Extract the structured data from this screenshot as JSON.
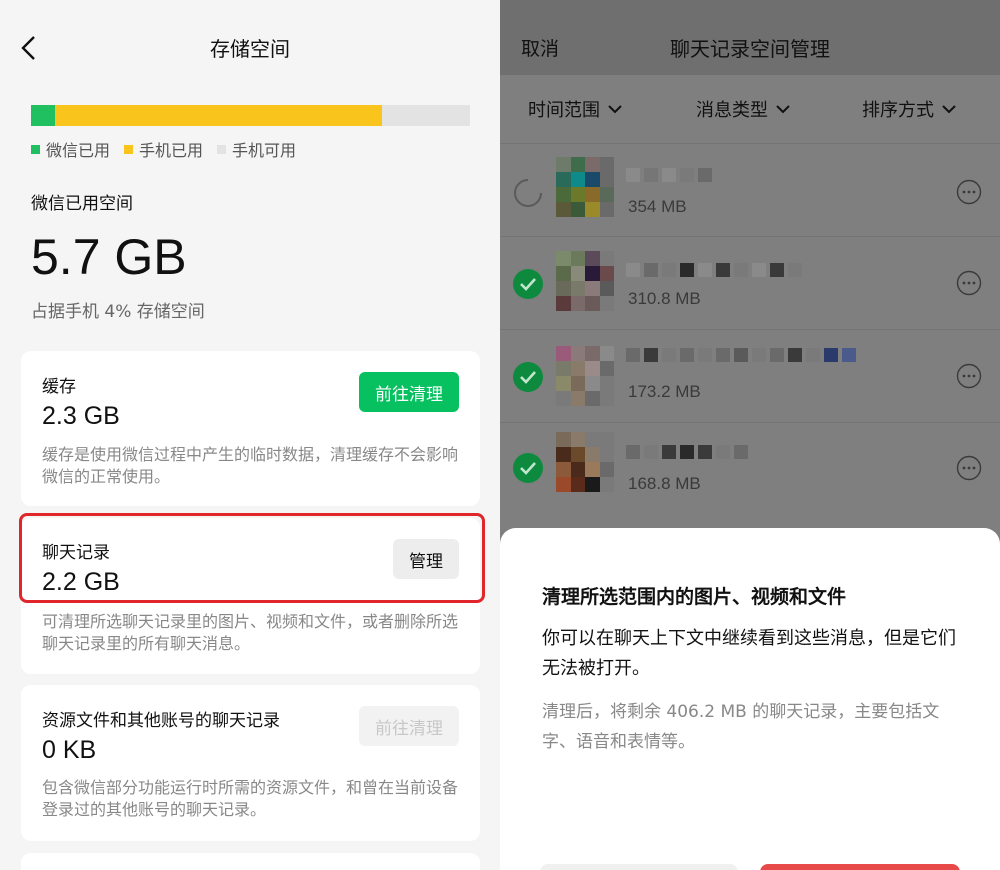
{
  "left": {
    "title": "存储空间",
    "usage_bar": {
      "wechat_used_fraction": 0.055,
      "phone_used_fraction": 0.745
    },
    "legend": [
      {
        "label": "微信已用",
        "color": "#20c060"
      },
      {
        "label": "手机已用",
        "color": "#f9c41c"
      },
      {
        "label": "手机可用",
        "color": "#e3e3e3"
      }
    ],
    "used_label": "微信已用空间",
    "used_value": "5.7 GB",
    "used_note": "占据手机 4% 存储空间",
    "cards": [
      {
        "title": "缓存",
        "size": "2.3 GB",
        "desc": "缓存是使用微信过程中产生的临时数据，清理缓存不会影响微信的正常使用。",
        "button": "前往清理"
      },
      {
        "title": "聊天记录",
        "size": "2.2 GB",
        "desc": "可清理所选聊天记录里的图片、视频和文件，或者删除所选聊天记录里的所有聊天消息。",
        "button": "管理"
      },
      {
        "title": "资源文件和其他账号的聊天记录",
        "size": "0 KB",
        "desc": "包含微信部分功能运行时所需的资源文件，和曾在当前设备登录过的其他账号的聊天记录。",
        "button": "前往清理"
      }
    ]
  },
  "right": {
    "cancel": "取消",
    "title": "聊天记录空间管理",
    "filters": [
      "时间范围",
      "消息类型",
      "排序方式"
    ],
    "rows": [
      {
        "size": "354 MB",
        "checked": false
      },
      {
        "size": "310.8 MB",
        "checked": true
      },
      {
        "size": "173.2 MB",
        "checked": true
      },
      {
        "size": "168.8 MB",
        "checked": true
      }
    ],
    "sheet": {
      "title": "清理所选范围内的图片、视频和文件",
      "text": "你可以在聊天上下文中继续看到这些消息，但是它们无法被打开。",
      "note": "清理后，将剩余 406.2 MB 的聊天记录，主要包括文字、语音和表情等。"
    }
  }
}
